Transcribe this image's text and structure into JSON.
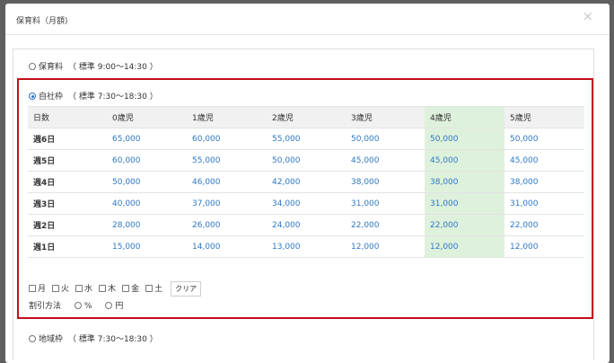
{
  "dialog": {
    "title": "保育料（月額)",
    "close_symbol": "×"
  },
  "options": [
    {
      "label": "保育料",
      "note": "（ 標準 9:00～14:30 ）",
      "selected": false
    },
    {
      "label": "自社枠",
      "note": "（ 標準 7:30～18:30 ）",
      "selected": true
    },
    {
      "label": "地域枠",
      "note": "（ 標準 7:30～18:30 ）",
      "selected": false
    }
  ],
  "table": {
    "headers": [
      "日数",
      "0歳児",
      "1歳児",
      "2歳児",
      "3歳児",
      "4歳児",
      "5歳児"
    ],
    "highlight_column": 5,
    "highlight_color": "#def1dc",
    "rows": [
      {
        "label": "週6日",
        "values": [
          "65,000",
          "60,000",
          "55,000",
          "50,000",
          "50,000",
          "50,000"
        ]
      },
      {
        "label": "週5日",
        "values": [
          "60,000",
          "55,000",
          "50,000",
          "45,000",
          "45,000",
          "45,000"
        ]
      },
      {
        "label": "週4日",
        "values": [
          "50,000",
          "46,000",
          "42,000",
          "38,000",
          "38,000",
          "38,000"
        ]
      },
      {
        "label": "週3日",
        "values": [
          "40,000",
          "37,000",
          "34,000",
          "31,000",
          "31,000",
          "31,000"
        ]
      },
      {
        "label": "週2日",
        "values": [
          "28,000",
          "26,000",
          "24,000",
          "22,000",
          "22,000",
          "22,000"
        ]
      },
      {
        "label": "週1日",
        "values": [
          "15,000",
          "14,000",
          "13,000",
          "12,000",
          "12,000",
          "12,000"
        ]
      }
    ]
  },
  "days": [
    "月",
    "火",
    "水",
    "木",
    "金",
    "土"
  ],
  "clear_label": "クリア",
  "discount": {
    "label": "割引方法",
    "options": [
      "%",
      "円"
    ]
  },
  "colors": {
    "accent_border": "#c40f1a",
    "value_text": "#2f78c4"
  }
}
